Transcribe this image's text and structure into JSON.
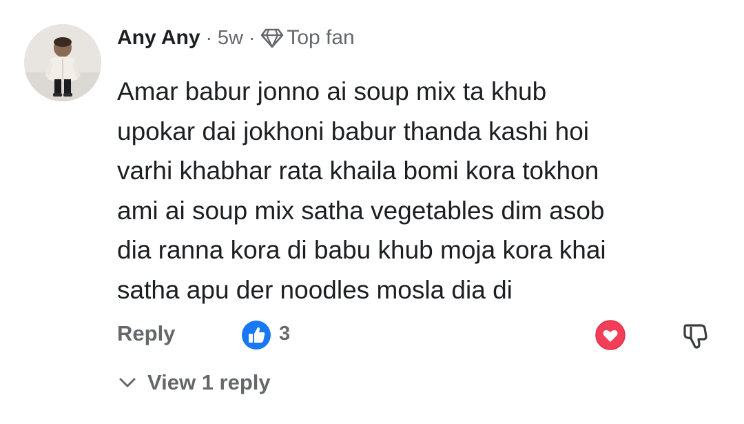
{
  "comment": {
    "author": "Any Any",
    "separator": "·",
    "time_ago": "5w",
    "badge_icon": "diamond-icon",
    "badge_label": "Top fan",
    "text": "Amar babur jonno ai soup mix ta khub\nupokar dai jokhoni babur thanda kashi hoi\nvarhi khabhar rata khaila bomi kora tokhon\nami ai soup mix satha vegetables dim asob\ndia ranna kora di babu khub moja kora khai\nsatha apu der noodles mosla dia di"
  },
  "actions": {
    "reply_label": "Reply",
    "like_icon": "thumbs-up-icon",
    "like_count": "3",
    "love_icon": "heart-icon",
    "dislike_icon": "thumbs-down-icon"
  },
  "replies": {
    "chevron_icon": "chevron-down-icon",
    "view_label": "View 1 reply"
  },
  "colors": {
    "text_primary": "#1c1e21",
    "text_secondary": "#65676b",
    "like_blue": "#1877f2",
    "love_red": "#f33e58"
  }
}
